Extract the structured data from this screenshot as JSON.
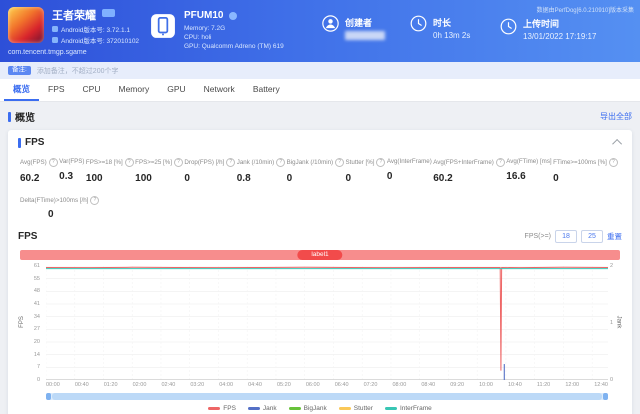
{
  "header": {
    "app": {
      "title": "王者荣耀",
      "version_lines": [
        {
          "label": "Android版本号:",
          "value": "3.72.1.1"
        },
        {
          "label": "Android版本号:",
          "value": "372010102"
        }
      ],
      "package": "com.tencent.tmgp.sgame"
    },
    "device": {
      "name": "PFUM10",
      "memory": "Memory: 7.2G",
      "cpu": "CPU: holi",
      "gpu": "GPU: Qualcomm Adreno (TM) 619"
    },
    "creator_label": "创建者",
    "duration_label": "时长",
    "duration_value": "0h 13m 2s",
    "upload_label": "上传时间",
    "upload_value": "13/01/2022 17:19:17",
    "collector_note": "数据由PerfDog[6.0.210910]版本采集"
  },
  "note_bar": {
    "label": "备注:",
    "placeholder": "添加备注，不超过200个字"
  },
  "tabs": [
    {
      "label": "概览",
      "active": true
    },
    {
      "label": "FPS",
      "active": false
    },
    {
      "label": "CPU",
      "active": false
    },
    {
      "label": "Memory",
      "active": false
    },
    {
      "label": "GPU",
      "active": false
    },
    {
      "label": "Network",
      "active": false
    },
    {
      "label": "Battery",
      "active": false
    }
  ],
  "overview": {
    "title": "概览",
    "export_label": "导出全部"
  },
  "fps_section": {
    "title": "FPS",
    "chart_title": "FPS",
    "stats": [
      {
        "name": "Avg(FPS)",
        "value": "60.2",
        "help": true
      },
      {
        "name": "Var(FPS)",
        "value": "0.3",
        "help": false
      },
      {
        "name": "FPS>=18 [%]",
        "value": "100",
        "help": true
      },
      {
        "name": "FPS>=25 [%]",
        "value": "100",
        "help": true
      },
      {
        "name": "Drop(FPS) [/h]",
        "value": "0",
        "help": true
      },
      {
        "name": "Jank (/10min)",
        "value": "0.8",
        "help": true
      },
      {
        "name": "BigJank (/10min)",
        "value": "0",
        "help": true
      },
      {
        "name": "Stutter [%]",
        "value": "0",
        "help": true
      },
      {
        "name": "Avg(InterFrame)",
        "value": "0",
        "help": false
      },
      {
        "name": "Avg(FPS+InterFrame)",
        "value": "60.2",
        "help": true
      },
      {
        "name": "Avg(FTime) [ms]",
        "value": "16.6",
        "help": false
      },
      {
        "name": "FTime>=100ms [%]",
        "value": "0",
        "help": true
      }
    ],
    "extra_stat": {
      "name": "Delta(FTime)>100ms [/h]",
      "value": "0",
      "help": true
    },
    "filter": {
      "label": "FPS(>=)",
      "low": "18",
      "high": "25",
      "reset_label": "重置"
    },
    "scene_label": "label1"
  },
  "chart_data": {
    "type": "line",
    "title": "FPS",
    "duration_seconds": 782,
    "x_label_ticks": [
      "00:00",
      "00:40",
      "01:20",
      "02:00",
      "02:40",
      "03:20",
      "04:00",
      "04:40",
      "05:20",
      "06:00",
      "06:40",
      "07:20",
      "08:00",
      "08:40",
      "09:20",
      "10:00",
      "10:40",
      "11:20",
      "12:00",
      "12:40"
    ],
    "y_left": {
      "label": "FPS",
      "ticks": [
        61,
        55,
        48,
        41,
        34,
        27,
        20,
        14,
        7,
        0
      ],
      "range": [
        0,
        61
      ]
    },
    "y_right": {
      "label": "Jank",
      "ticks": [
        2,
        1,
        0
      ],
      "range": [
        0,
        2
      ]
    },
    "series": [
      {
        "name": "FPS",
        "color": "#ee6666"
      },
      {
        "name": "Jank",
        "color": "#5470c6"
      },
      {
        "name": "BigJank",
        "color": "#67c23a"
      },
      {
        "name": "Stutter",
        "color": "#fac858"
      },
      {
        "name": "InterFrame",
        "color": "#38c6b4"
      }
    ],
    "sampled": {
      "x": [
        "00:00",
        "01:00",
        "02:00",
        "03:00",
        "04:00",
        "05:00",
        "06:00",
        "07:00",
        "08:00",
        "09:00",
        "10:00",
        "10:32",
        "10:33",
        "10:34",
        "11:00",
        "12:00",
        "13:02"
      ],
      "fps": [
        60.2,
        60.1,
        60.3,
        60.2,
        60.1,
        60.2,
        60.3,
        60.2,
        60.1,
        60.2,
        60.2,
        60.2,
        5,
        60.2,
        60.1,
        60.3,
        60.2
      ],
      "jank": [
        0,
        0,
        0,
        0,
        0,
        0,
        0,
        0,
        0,
        0,
        0,
        0,
        1,
        0,
        0,
        0,
        0
      ]
    },
    "legend_position": "bottom",
    "grid": true
  }
}
